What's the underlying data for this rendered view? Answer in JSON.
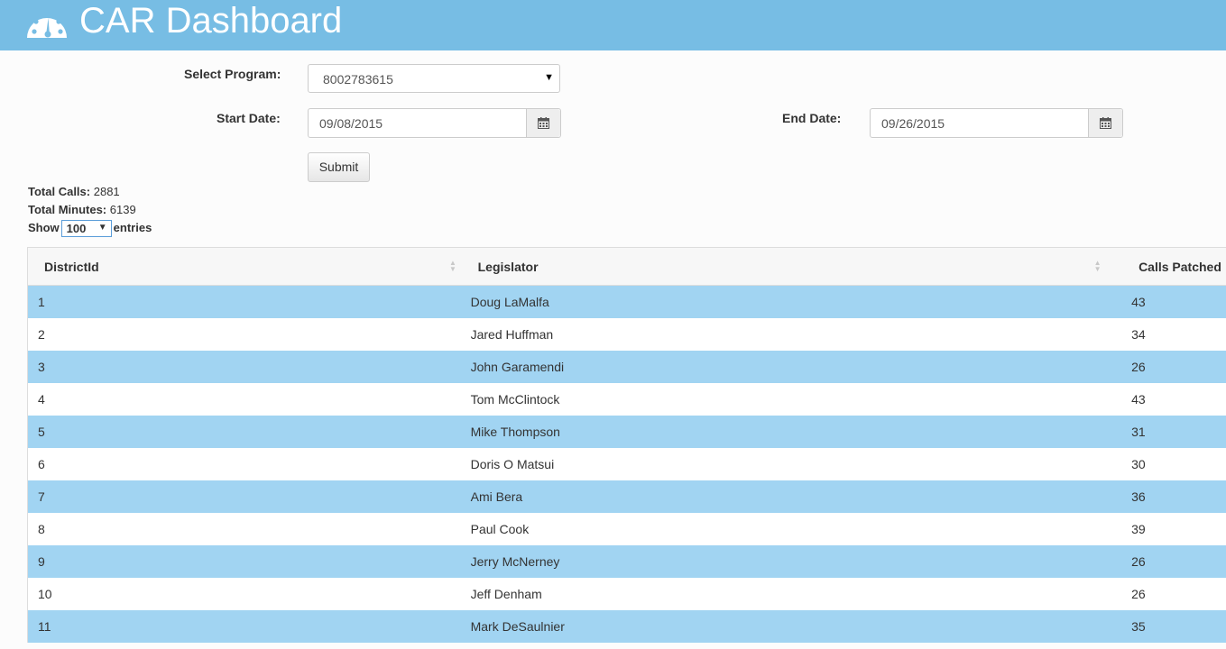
{
  "header": {
    "title": "CAR Dashboard",
    "icon": "dashboard-icon"
  },
  "form": {
    "program_label": "Select Program:",
    "program_value": "8002783615",
    "start_label": "Start Date:",
    "start_value": "09/08/2015",
    "end_label": "End Date:",
    "end_value": "09/26/2015",
    "submit_label": "Submit"
  },
  "stats": {
    "total_calls_label": "Total Calls:",
    "total_calls_value": "2881",
    "total_minutes_label": "Total Minutes:",
    "total_minutes_value": "6139",
    "show_label": "Show",
    "entries_value": "100",
    "entries_label": "entries"
  },
  "table": {
    "columns": [
      "DistrictId",
      "Legislator",
      "Calls Patched"
    ],
    "rows": [
      {
        "district": "1",
        "legislator": "Doug LaMalfa",
        "calls": "43"
      },
      {
        "district": "2",
        "legislator": "Jared Huffman",
        "calls": "34"
      },
      {
        "district": "3",
        "legislator": "John Garamendi",
        "calls": "26"
      },
      {
        "district": "4",
        "legislator": "Tom McClintock",
        "calls": "43"
      },
      {
        "district": "5",
        "legislator": "Mike Thompson",
        "calls": "31"
      },
      {
        "district": "6",
        "legislator": "Doris O Matsui",
        "calls": "30"
      },
      {
        "district": "7",
        "legislator": "Ami Bera",
        "calls": "36"
      },
      {
        "district": "8",
        "legislator": "Paul Cook",
        "calls": "39"
      },
      {
        "district": "9",
        "legislator": "Jerry McNerney",
        "calls": "26"
      },
      {
        "district": "10",
        "legislator": "Jeff Denham",
        "calls": "26"
      },
      {
        "district": "11",
        "legislator": "Mark DeSaulnier",
        "calls": "35"
      }
    ]
  },
  "colors": {
    "header_bg": "#77bde4",
    "row_highlight": "#a1d4f2"
  }
}
